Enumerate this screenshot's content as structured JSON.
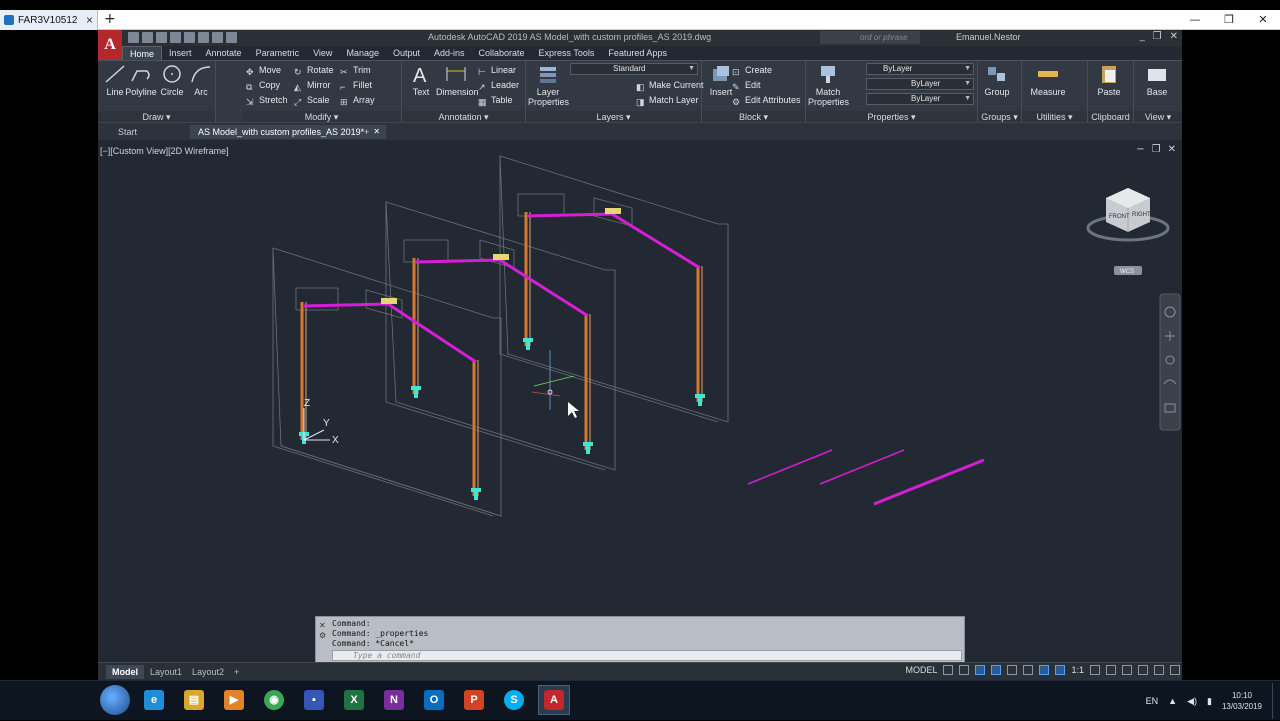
{
  "browser": {
    "tab_title": "FAR3V10512",
    "new_tab": "+",
    "controls": [
      "—",
      "❐",
      "✕"
    ]
  },
  "app": {
    "logo": "A",
    "title": "Autodesk AutoCAD 2019   AS Model_with custom profiles_AS 2019.dwg",
    "search_placeholder": "ord or phrase",
    "user": "Emanuel.Nestor",
    "window_controls": [
      "_",
      "❐",
      "✕"
    ]
  },
  "ribbon": {
    "tabs": [
      "Home",
      "Insert",
      "Annotate",
      "Parametric",
      "View",
      "Manage",
      "Output",
      "Add-ins",
      "Collaborate",
      "Express Tools",
      "Featured Apps"
    ],
    "active_tab": "Home",
    "draw": {
      "title": "Draw ▾",
      "line": "Line",
      "polyline": "Polyline",
      "circle": "Circle",
      "arc": "Arc"
    },
    "modify": {
      "title": "Modify ▾",
      "move": "Move",
      "rotate": "Rotate",
      "trim": "Trim",
      "copy": "Copy",
      "mirror": "Mirror",
      "fillet": "Fillet",
      "stretch": "Stretch",
      "scale": "Scale",
      "array": "Array"
    },
    "annotation": {
      "title": "Annotation ▾",
      "text": "Text",
      "dimension": "Dimension",
      "linear": "Linear",
      "leader": "Leader",
      "table": "Table"
    },
    "layers": {
      "title": "Layers ▾",
      "layer_properties": "Layer Properties",
      "layer_current": "Standard",
      "make_current": "Make Current",
      "match_layer": "Match Layer"
    },
    "block": {
      "title": "Block ▾",
      "insert": "Insert",
      "create": "Create",
      "edit": "Edit",
      "edit_attributes": "Edit Attributes"
    },
    "properties": {
      "title": "Properties ▾",
      "match_properties": "Match Properties",
      "color": "ByLayer",
      "linetype": "ByLayer",
      "lineweight": "ByLayer"
    },
    "groups": {
      "title": "Groups ▾",
      "group": "Group"
    },
    "utilities": {
      "title": "Utilities ▾",
      "measure": "Measure"
    },
    "clipboard": {
      "title": "Clipboard",
      "paste": "Paste"
    },
    "view": {
      "title": "View ▾",
      "base": "Base"
    }
  },
  "doc_tabs": {
    "start": "Start",
    "active": "AS Model_with custom profiles_AS 2019*",
    "close": "✕",
    "add": "+"
  },
  "viewport": {
    "label": "[−][Custom View][2D Wireframe]",
    "controls": [
      "−",
      "❐",
      "✕"
    ],
    "viewcube": {
      "front": "FRONT",
      "right": "RIGHT",
      "wcs": "WCS"
    },
    "ucs": {
      "x": "X",
      "y": "Y",
      "z": "Z"
    }
  },
  "command": {
    "history": [
      "Command:",
      "Command: _properties",
      "Command: *Cancel*"
    ],
    "placeholder": "Type a command"
  },
  "layout_tabs": {
    "model": "Model",
    "layout1": "Layout1",
    "layout2": "Layout2",
    "add": "+"
  },
  "status": {
    "model": "MODEL",
    "scale": "1:1"
  },
  "taskbar": {
    "apps": [
      {
        "name": "ie",
        "color": "#1e8fd6",
        "glyph": "e"
      },
      {
        "name": "explorer",
        "color": "#d9a72c",
        "glyph": "▤"
      },
      {
        "name": "media",
        "color": "#e2832a",
        "glyph": "▶"
      },
      {
        "name": "chrome",
        "color": "#3aa757",
        "glyph": "◉"
      },
      {
        "name": "save",
        "color": "#3856b8",
        "glyph": "▪"
      },
      {
        "name": "excel",
        "color": "#1f7244",
        "glyph": "X"
      },
      {
        "name": "onenote",
        "color": "#7a2d9c",
        "glyph": "N"
      },
      {
        "name": "outlook",
        "color": "#0a6cbc",
        "glyph": "O"
      },
      {
        "name": "powerpoint",
        "color": "#d04423",
        "glyph": "P"
      },
      {
        "name": "skype",
        "color": "#00aff0",
        "glyph": "S"
      },
      {
        "name": "autocad",
        "color": "#c0282c",
        "glyph": "A"
      }
    ],
    "lang": "EN",
    "time": "10:10",
    "date": "13/03/2019"
  },
  "colors": {
    "viewport_bg": "#222933",
    "beam_magenta": "#d81dd8",
    "column_orange": "#d6782c",
    "base_cyan": "#3fe6d8",
    "frame_gray": "#8a8f98"
  }
}
